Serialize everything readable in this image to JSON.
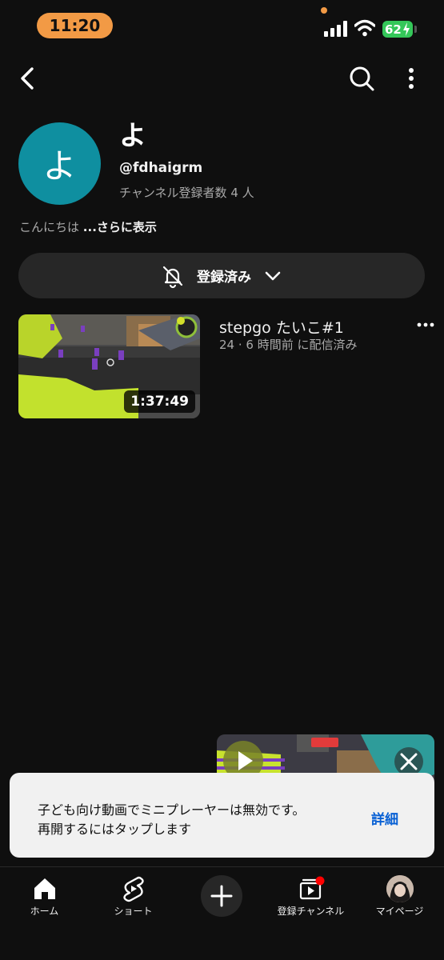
{
  "status_bar": {
    "time": "11:20",
    "battery": "62"
  },
  "channel": {
    "avatar_initial": "よ",
    "name": "よ",
    "handle": "@fdhaigrm",
    "subscribers": "チャンネル登録者数 4 人",
    "description": "こんにちは",
    "description_more": "...さらに表示",
    "subscribe_label": "登録済み"
  },
  "videos": [
    {
      "title": "stepgo たいこ#1",
      "meta": "24 · 6 時間前 に配信済み",
      "duration": "1:37:49"
    }
  ],
  "toast": {
    "line1": "子ども向け動画でミニプレーヤーは無効です。",
    "line2": "再開するにはタップします",
    "action": "詳細"
  },
  "bottom_nav": {
    "home": "ホーム",
    "shorts": "ショート",
    "subscriptions": "登録チャンネル",
    "my_page": "マイページ"
  },
  "colors": {
    "background": "#0f0f0f",
    "avatar": "#0f8fa0",
    "link": "#065fd4",
    "status_pill": "#f29a45",
    "battery": "#34c759",
    "notification_dot": "#ff0000"
  }
}
